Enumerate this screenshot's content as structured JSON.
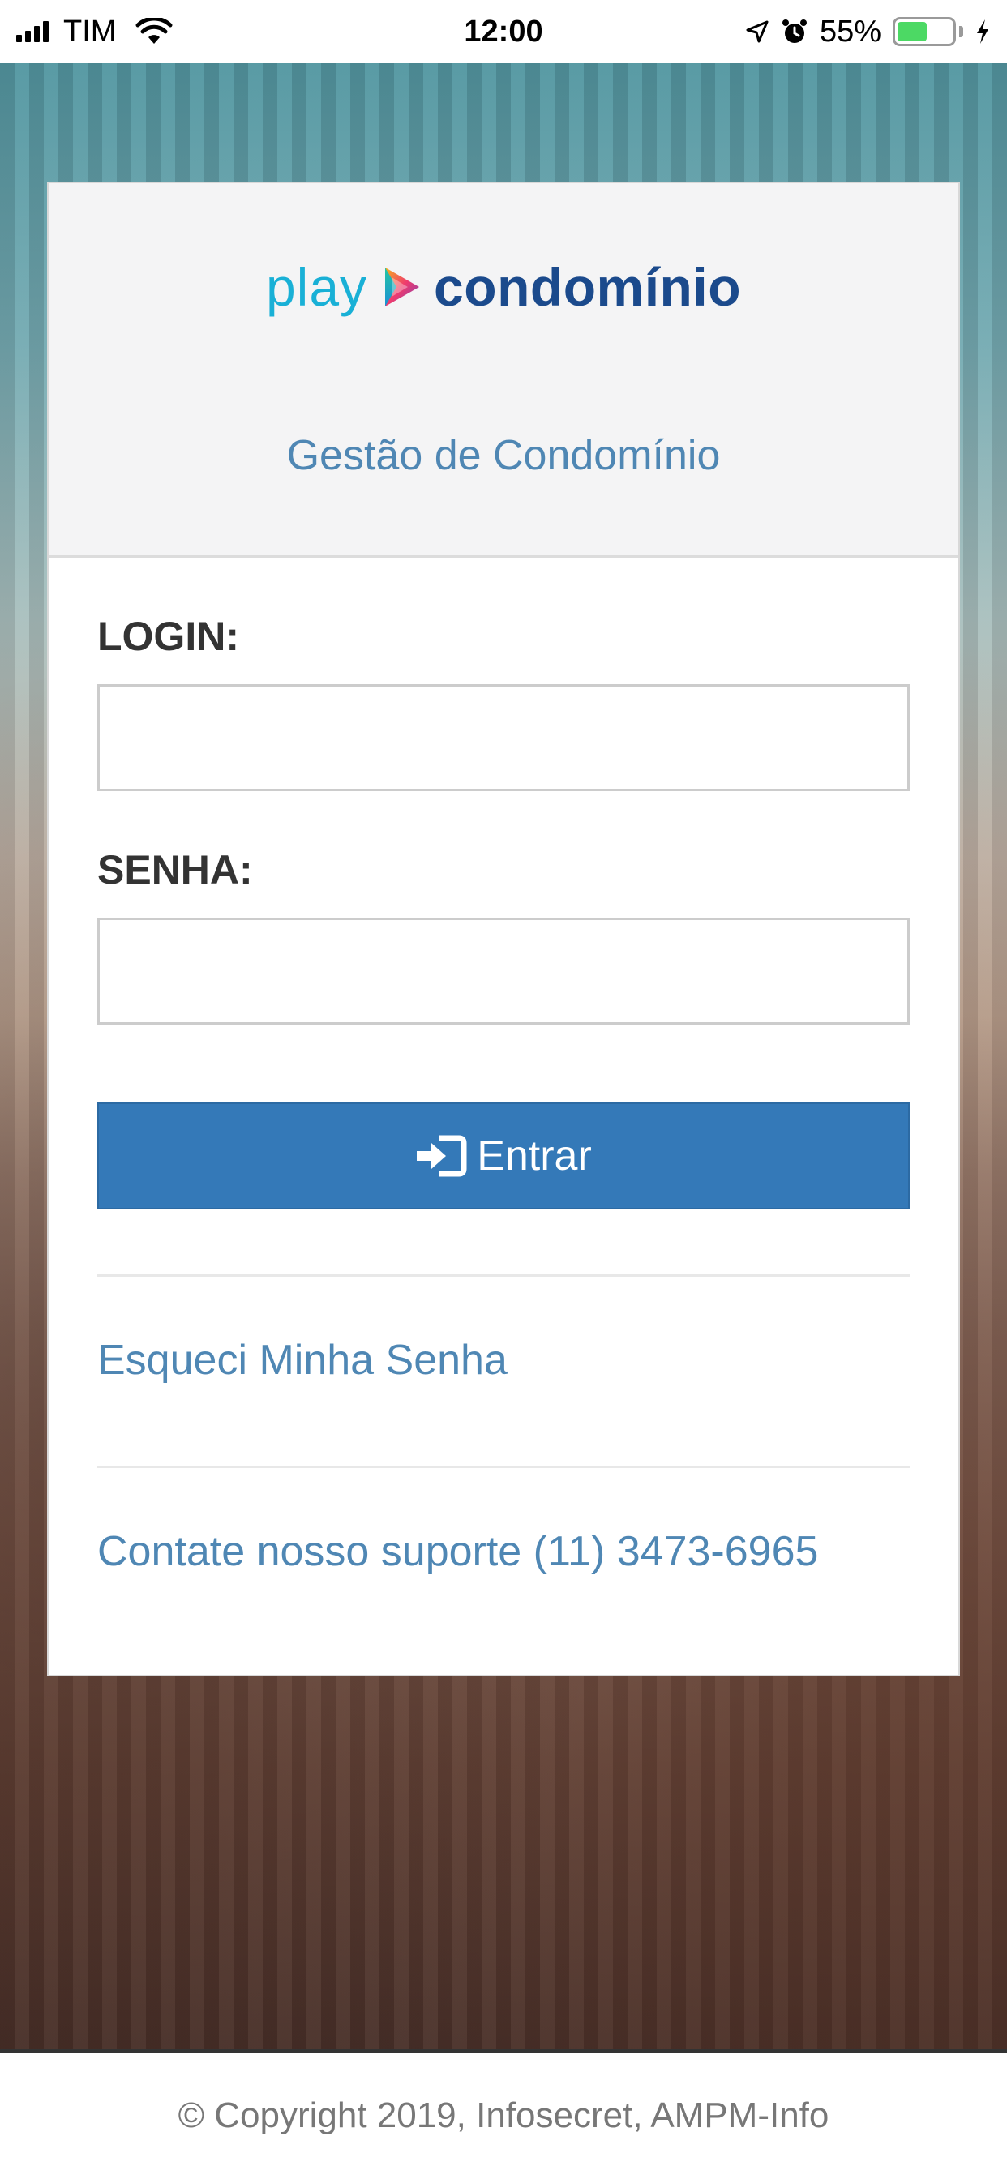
{
  "status_bar": {
    "carrier": "TIM",
    "time": "12:00",
    "battery_percent": "55%",
    "battery_level": 0.55,
    "icons": [
      "signal-icon",
      "wifi-icon",
      "location-icon",
      "alarm-icon",
      "battery-icon",
      "charging-icon"
    ]
  },
  "brand": {
    "logo_play": "play",
    "logo_condominio": "condomínio",
    "subtitle": "Gestão de Condomínio",
    "colors": {
      "play": "#19b0d6",
      "condominio": "#1b4a8c",
      "accent": "#3479b8",
      "link": "#4f87b4"
    }
  },
  "form": {
    "login_label": "LOGIN:",
    "login_value": "",
    "senha_label": "SENHA:",
    "senha_value": "",
    "submit_label": "Entrar",
    "submit_icon": "sign-in-icon"
  },
  "links": {
    "forgot_password": "Esqueci Minha Senha",
    "support": "Contate nosso suporte (11) 3473-6965"
  },
  "footer": {
    "copyright": "© Copyright 2019, Infosecret, AMPM-Info"
  }
}
